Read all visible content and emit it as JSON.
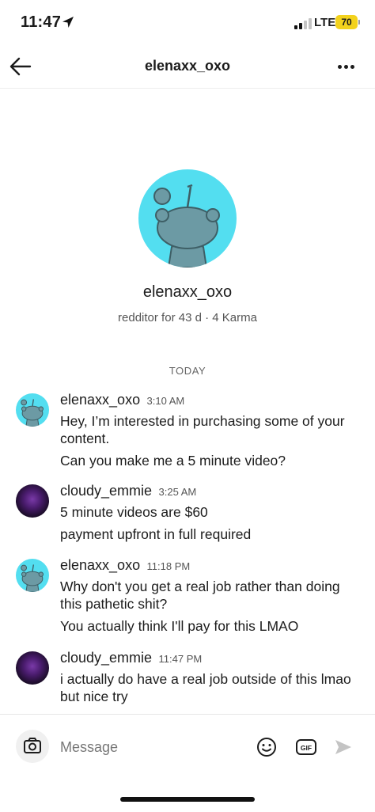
{
  "status_bar": {
    "time": "11:47",
    "network": "LTE",
    "battery": "70"
  },
  "header": {
    "title": "elenaxx_oxo",
    "back_icon": "back-arrow-icon",
    "more_icon": "more-horizontal-icon"
  },
  "profile": {
    "name": "elenaxx_oxo",
    "meta": "redditor for 43 d · 4 Karma",
    "avatar_color": "#53def0"
  },
  "day_label": "TODAY",
  "messages": [
    {
      "user": "elenaxx_oxo",
      "time": "3:10 AM",
      "lines": [
        "Hey, I’m interested in purchasing some of your content.",
        "Can you make me a 5 minute video?"
      ]
    },
    {
      "user": "cloudy_emmie",
      "time": "3:25 AM",
      "lines": [
        "5 minute videos are $60",
        "payment upfront in full required"
      ]
    },
    {
      "user": "elenaxx_oxo",
      "time": "11:18 PM",
      "lines": [
        "Why don't you get a real job rather than doing this pathetic shit?",
        "You actually think I'll pay for this LMAO"
      ]
    },
    {
      "user": "cloudy_emmie",
      "time": "11:47 PM",
      "lines": [
        "i actually do have a real job outside of this lmao but nice try"
      ]
    }
  ],
  "composer": {
    "placeholder": "Message",
    "camera_icon": "camera-icon",
    "emoji_icon": "emoji-icon",
    "gif_label": "GIF",
    "send_icon": "send-icon"
  }
}
